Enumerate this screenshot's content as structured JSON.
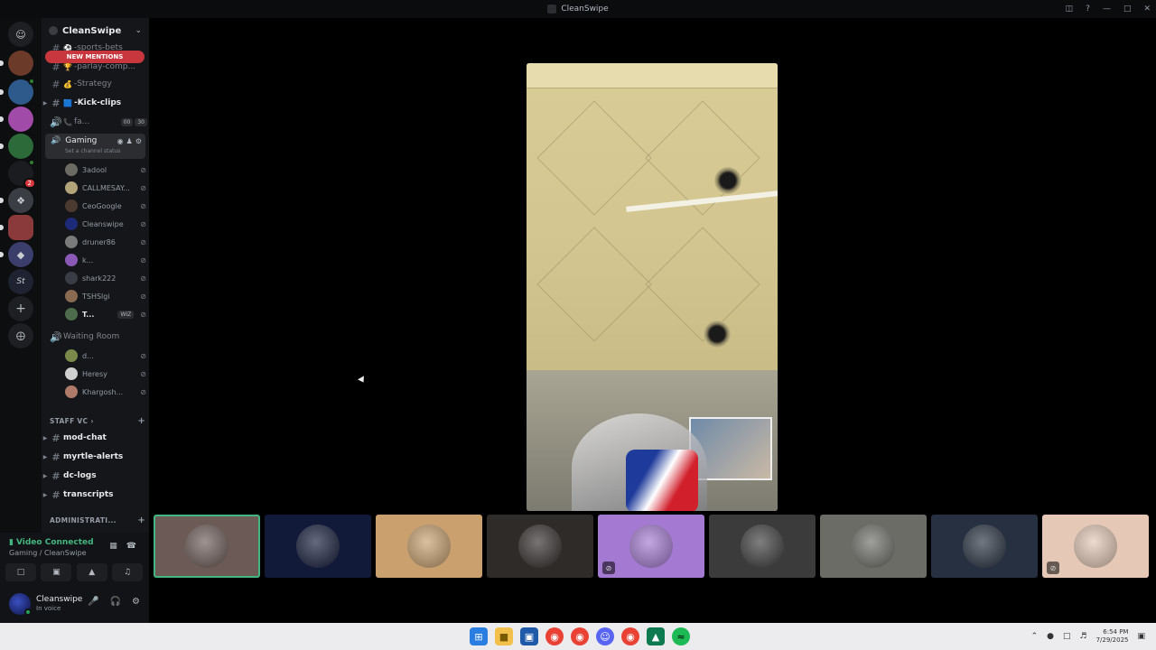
{
  "window": {
    "title": "CleanSwipe"
  },
  "server": {
    "name": "CleanSwipe",
    "new_mentions": "NEW MENTIONS"
  },
  "channels": [
    {
      "label": "-sports-bets",
      "emoji": "⚽"
    },
    {
      "label": "-parlay-comp...",
      "emoji": "🏆"
    },
    {
      "label": "-Strategy",
      "emoji": "💰"
    },
    {
      "label": "-Kick-clips",
      "emoji": "🟦"
    },
    {
      "label": "fa...",
      "emoji": "📞",
      "pill_a": "00",
      "pill_b": "30"
    }
  ],
  "voice_channel": {
    "name": "Gaming",
    "status": "Set a channel status"
  },
  "gaming_members": [
    {
      "name": "3adool",
      "color": "#6b6a63"
    },
    {
      "name": "CALLMESAY...",
      "color": "#b3a57a"
    },
    {
      "name": "CeoGoogle",
      "color": "#4a3a2f"
    },
    {
      "name": "Cleanswipe",
      "color": "#1d2a78"
    },
    {
      "name": "druner86",
      "color": "#7a7a7a"
    },
    {
      "name": "k...",
      "color": "#8a58b5"
    },
    {
      "name": "shark222",
      "color": "#3a3d45"
    },
    {
      "name": "TSHSlgi",
      "color": "#8a6a50"
    },
    {
      "name": "T...",
      "color": "#4e6b4c",
      "tag": "WIZ"
    }
  ],
  "waiting_room": {
    "name": "Waiting Room",
    "members": [
      {
        "name": "d...",
        "color": "#7b8a4a"
      },
      {
        "name": "Heresy",
        "color": "#cfcfcf"
      },
      {
        "name": "Khargosh...",
        "color": "#b07a68"
      }
    ]
  },
  "staff_category": "STAFF VC",
  "staff_channels": [
    "mod-chat",
    "myrtle-alerts",
    "dc-logs",
    "transcripts"
  ],
  "admin_category": "ADMINISTRATI...",
  "voice_status": {
    "connected": "Video Connected",
    "location": "Gaming / CleanSwipe"
  },
  "user": {
    "name": "Cleanswipe",
    "status": "In voice"
  },
  "clock": {
    "time": "6:54 PM",
    "date": "7/29/2025"
  },
  "tiles": [
    {
      "color": "#6b5a55",
      "muted": false,
      "active": true
    },
    {
      "color": "#121a3a",
      "muted": false
    },
    {
      "color": "#c9a06e",
      "muted": false
    },
    {
      "color": "#2f2b28",
      "muted": false
    },
    {
      "color": "#a479d1",
      "muted": true
    },
    {
      "color": "#3b3b3b",
      "muted": false
    },
    {
      "color": "#6c6c66",
      "muted": false
    },
    {
      "color": "#263040",
      "muted": false
    },
    {
      "color": "#e5c8b6",
      "muted": true
    }
  ]
}
